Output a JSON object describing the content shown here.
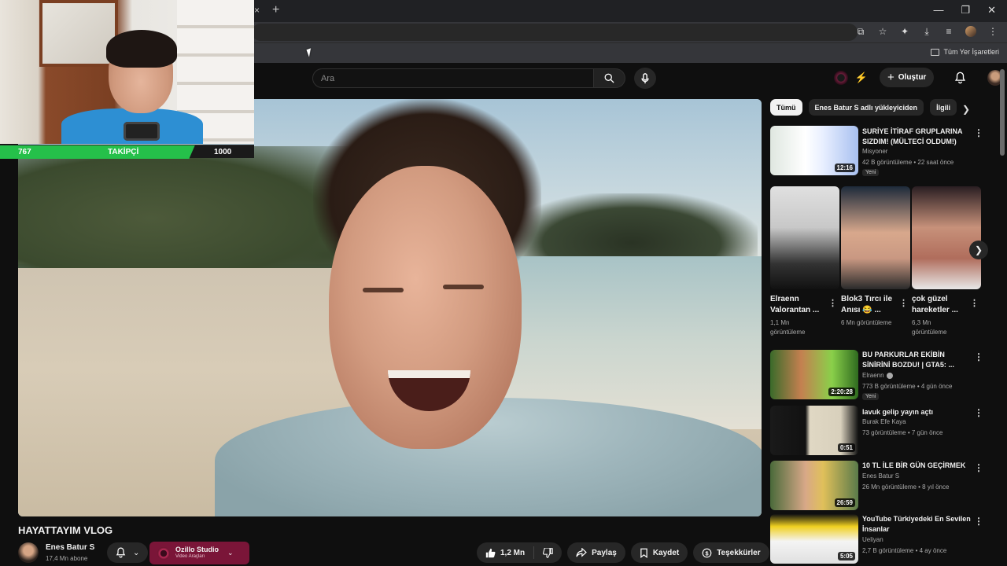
{
  "browser": {
    "tab_close": "×",
    "new_tab": "+",
    "bookmarks_label": "Tüm Yer İşaretleri"
  },
  "header": {
    "search_placeholder": "Ara",
    "create_label": "Oluştur"
  },
  "overlay": {
    "followers_current": "767",
    "followers_label": "TAKİPÇİ",
    "followers_goal": "1000",
    "progress_fraction": 0.767
  },
  "video": {
    "title": "HAYATTAYIM VLOG",
    "channel_name": "Enes Batur S",
    "channel_subs": "17,4 Mn abone",
    "sponsor_name": "Ozillo Studio",
    "sponsor_sub": "Video Araçları",
    "likes": "1,2 Mn",
    "share_label": "Paylaş",
    "save_label": "Kaydet",
    "thanks_label": "Teşekkürler"
  },
  "sidebar": {
    "chips": [
      "Tümü",
      "Enes Batur S adlı yükleyiciden",
      "İlgili"
    ],
    "recommendations": [
      {
        "title": "SURİYE İTİRAF GRUPLARINA SIZDIM! (MÜLTECİ OLDUM!)",
        "channel": "Misyoner",
        "meta": "42 B görüntüleme • 22 saat önce",
        "badge": "Yeni",
        "duration": "12:16"
      },
      {
        "title": "BU PARKURLAR EKİBİN SİNİRİNİ BOZDU! | GTA5: ...",
        "channel": "Elraenn",
        "meta": "773 B görüntüleme • 4 gün önce",
        "badge": "Yeni",
        "duration": "2:20:28"
      },
      {
        "title": "lavuk gelip yayın açtı",
        "channel": "Burak Efe Kaya",
        "meta": "73 görüntüleme • 7 gün önce",
        "badge": "",
        "duration": "0:51"
      },
      {
        "title": "10 TL İLE BİR GÜN GEÇİRMEK",
        "channel": "Enes Batur S",
        "meta": "26 Mn görüntüleme • 8 yıl önce",
        "badge": "",
        "duration": "26:59"
      },
      {
        "title": "YouTube Türkiyedeki En Sevilen İnsanlar",
        "channel": "Ueliyan",
        "meta": "2,7 B görüntüleme • 4 ay önce",
        "badge": "",
        "duration": "5:05"
      }
    ],
    "shorts": [
      {
        "title": "Elraenn Valorantan ...",
        "views": "1,1 Mn görüntüleme"
      },
      {
        "title": "Blok3 Tırcı ile Anısı 😂 ...",
        "views": "6 Mn görüntüleme"
      },
      {
        "title": "çok güzel hareketler ...",
        "views": "6,3 Mn görüntüleme"
      }
    ]
  },
  "icons": {
    "search": "search-icon",
    "mic": "mic-icon",
    "bell": "bell-icon",
    "like": "thumbs-up-icon",
    "dislike": "thumbs-down-icon",
    "share": "share-icon",
    "save": "bookmark-icon",
    "thanks": "thanks-icon",
    "more": "more-icon",
    "kebab": "⋮"
  },
  "colors": {
    "background": "#0f0f0f",
    "surface": "#272727",
    "follower_fill": "#25c04a",
    "sponsor": "#7a1538"
  }
}
